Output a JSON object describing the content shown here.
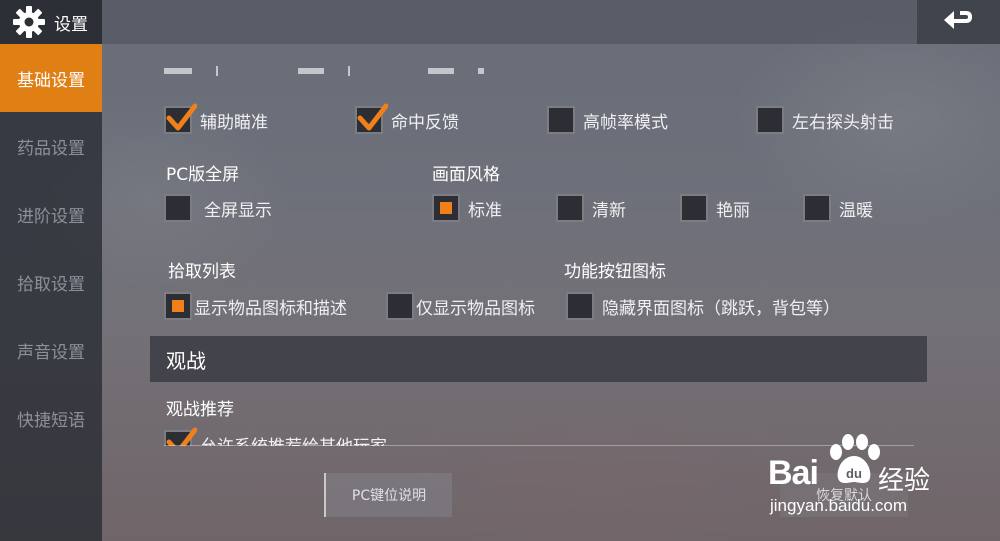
{
  "header": {
    "title": "设置",
    "gear_icon": "gear-icon",
    "back_icon": "return-arrow-icon"
  },
  "sidebar": {
    "items": [
      {
        "label": "基础设置",
        "active": true
      },
      {
        "label": "药品设置",
        "active": false
      },
      {
        "label": "进阶设置",
        "active": false
      },
      {
        "label": "拾取设置",
        "active": false
      },
      {
        "label": "声音设置",
        "active": false
      },
      {
        "label": "快捷短语",
        "active": false
      }
    ]
  },
  "aim_row": [
    {
      "label": "辅助瞄准",
      "checked": true
    },
    {
      "label": "命中反馈",
      "checked": true
    },
    {
      "label": "高帧率模式",
      "checked": false
    },
    {
      "label": "左右探头射击",
      "checked": false
    }
  ],
  "pc_fullscreen": {
    "title": "PC版全屏",
    "option": {
      "label": "全屏显示",
      "checked": false
    }
  },
  "style": {
    "title": "画面风格",
    "options": [
      {
        "label": "标准",
        "selected": true
      },
      {
        "label": "清新",
        "selected": false
      },
      {
        "label": "艳丽",
        "selected": false
      },
      {
        "label": "温暖",
        "selected": false
      }
    ]
  },
  "pickup_list": {
    "title": "拾取列表",
    "options": [
      {
        "label": "显示物品图标和描述",
        "selected": true
      },
      {
        "label": "仅显示物品图标",
        "selected": false
      }
    ]
  },
  "func_icon": {
    "title": "功能按钮图标",
    "option": {
      "label": "隐藏界面图标（跳跃，背包等）",
      "checked": false
    }
  },
  "spectate": {
    "header": "观战",
    "title": "观战推荐",
    "option": {
      "label": "允许系统推荐给其他玩家",
      "checked": true
    }
  },
  "buttons": {
    "pc_keys": "PC键位说明",
    "reset": "恢复默认"
  },
  "watermark": {
    "brand": "Bai",
    "brand2": "du",
    "cn": "经验",
    "url": "jingyan.baidu.com"
  },
  "colors": {
    "accent": "#e07f14",
    "check": "#f08019",
    "sidebar": "#2d3037"
  }
}
